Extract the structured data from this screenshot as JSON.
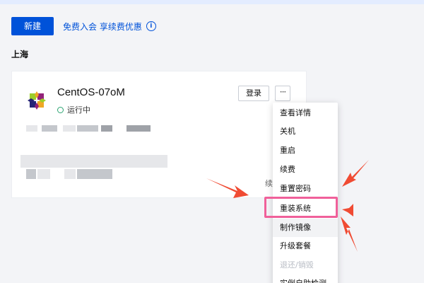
{
  "toolbar": {
    "new_button_label": "新建",
    "promo_text": "免费入会 享续费优惠",
    "info_icon": "info-circle-icon"
  },
  "region": {
    "title": "上海"
  },
  "instance": {
    "name": "CentOS-07oM",
    "status": "运行中",
    "login_button_label": "登录",
    "more_button_label": "···",
    "renew_text": "续",
    "os_icon": "centos-logo-icon"
  },
  "menu": {
    "items": [
      {
        "label": "查看详情",
        "disabled": false
      },
      {
        "label": "关机",
        "disabled": false
      },
      {
        "label": "重启",
        "disabled": false
      },
      {
        "label": "续费",
        "disabled": false
      },
      {
        "label": "重置密码",
        "disabled": false
      },
      {
        "label": "重装系统",
        "disabled": false
      },
      {
        "label": "制作镜像",
        "disabled": false
      },
      {
        "label": "升级套餐",
        "disabled": false
      },
      {
        "label": "退还/销毁",
        "disabled": true
      },
      {
        "label": "实例自助检测",
        "disabled": false
      }
    ]
  },
  "colors": {
    "accent": "#0052d9",
    "status_running": "#2ba471",
    "highlight": "#f0609a",
    "annotation_arrow": "#f04b33"
  }
}
